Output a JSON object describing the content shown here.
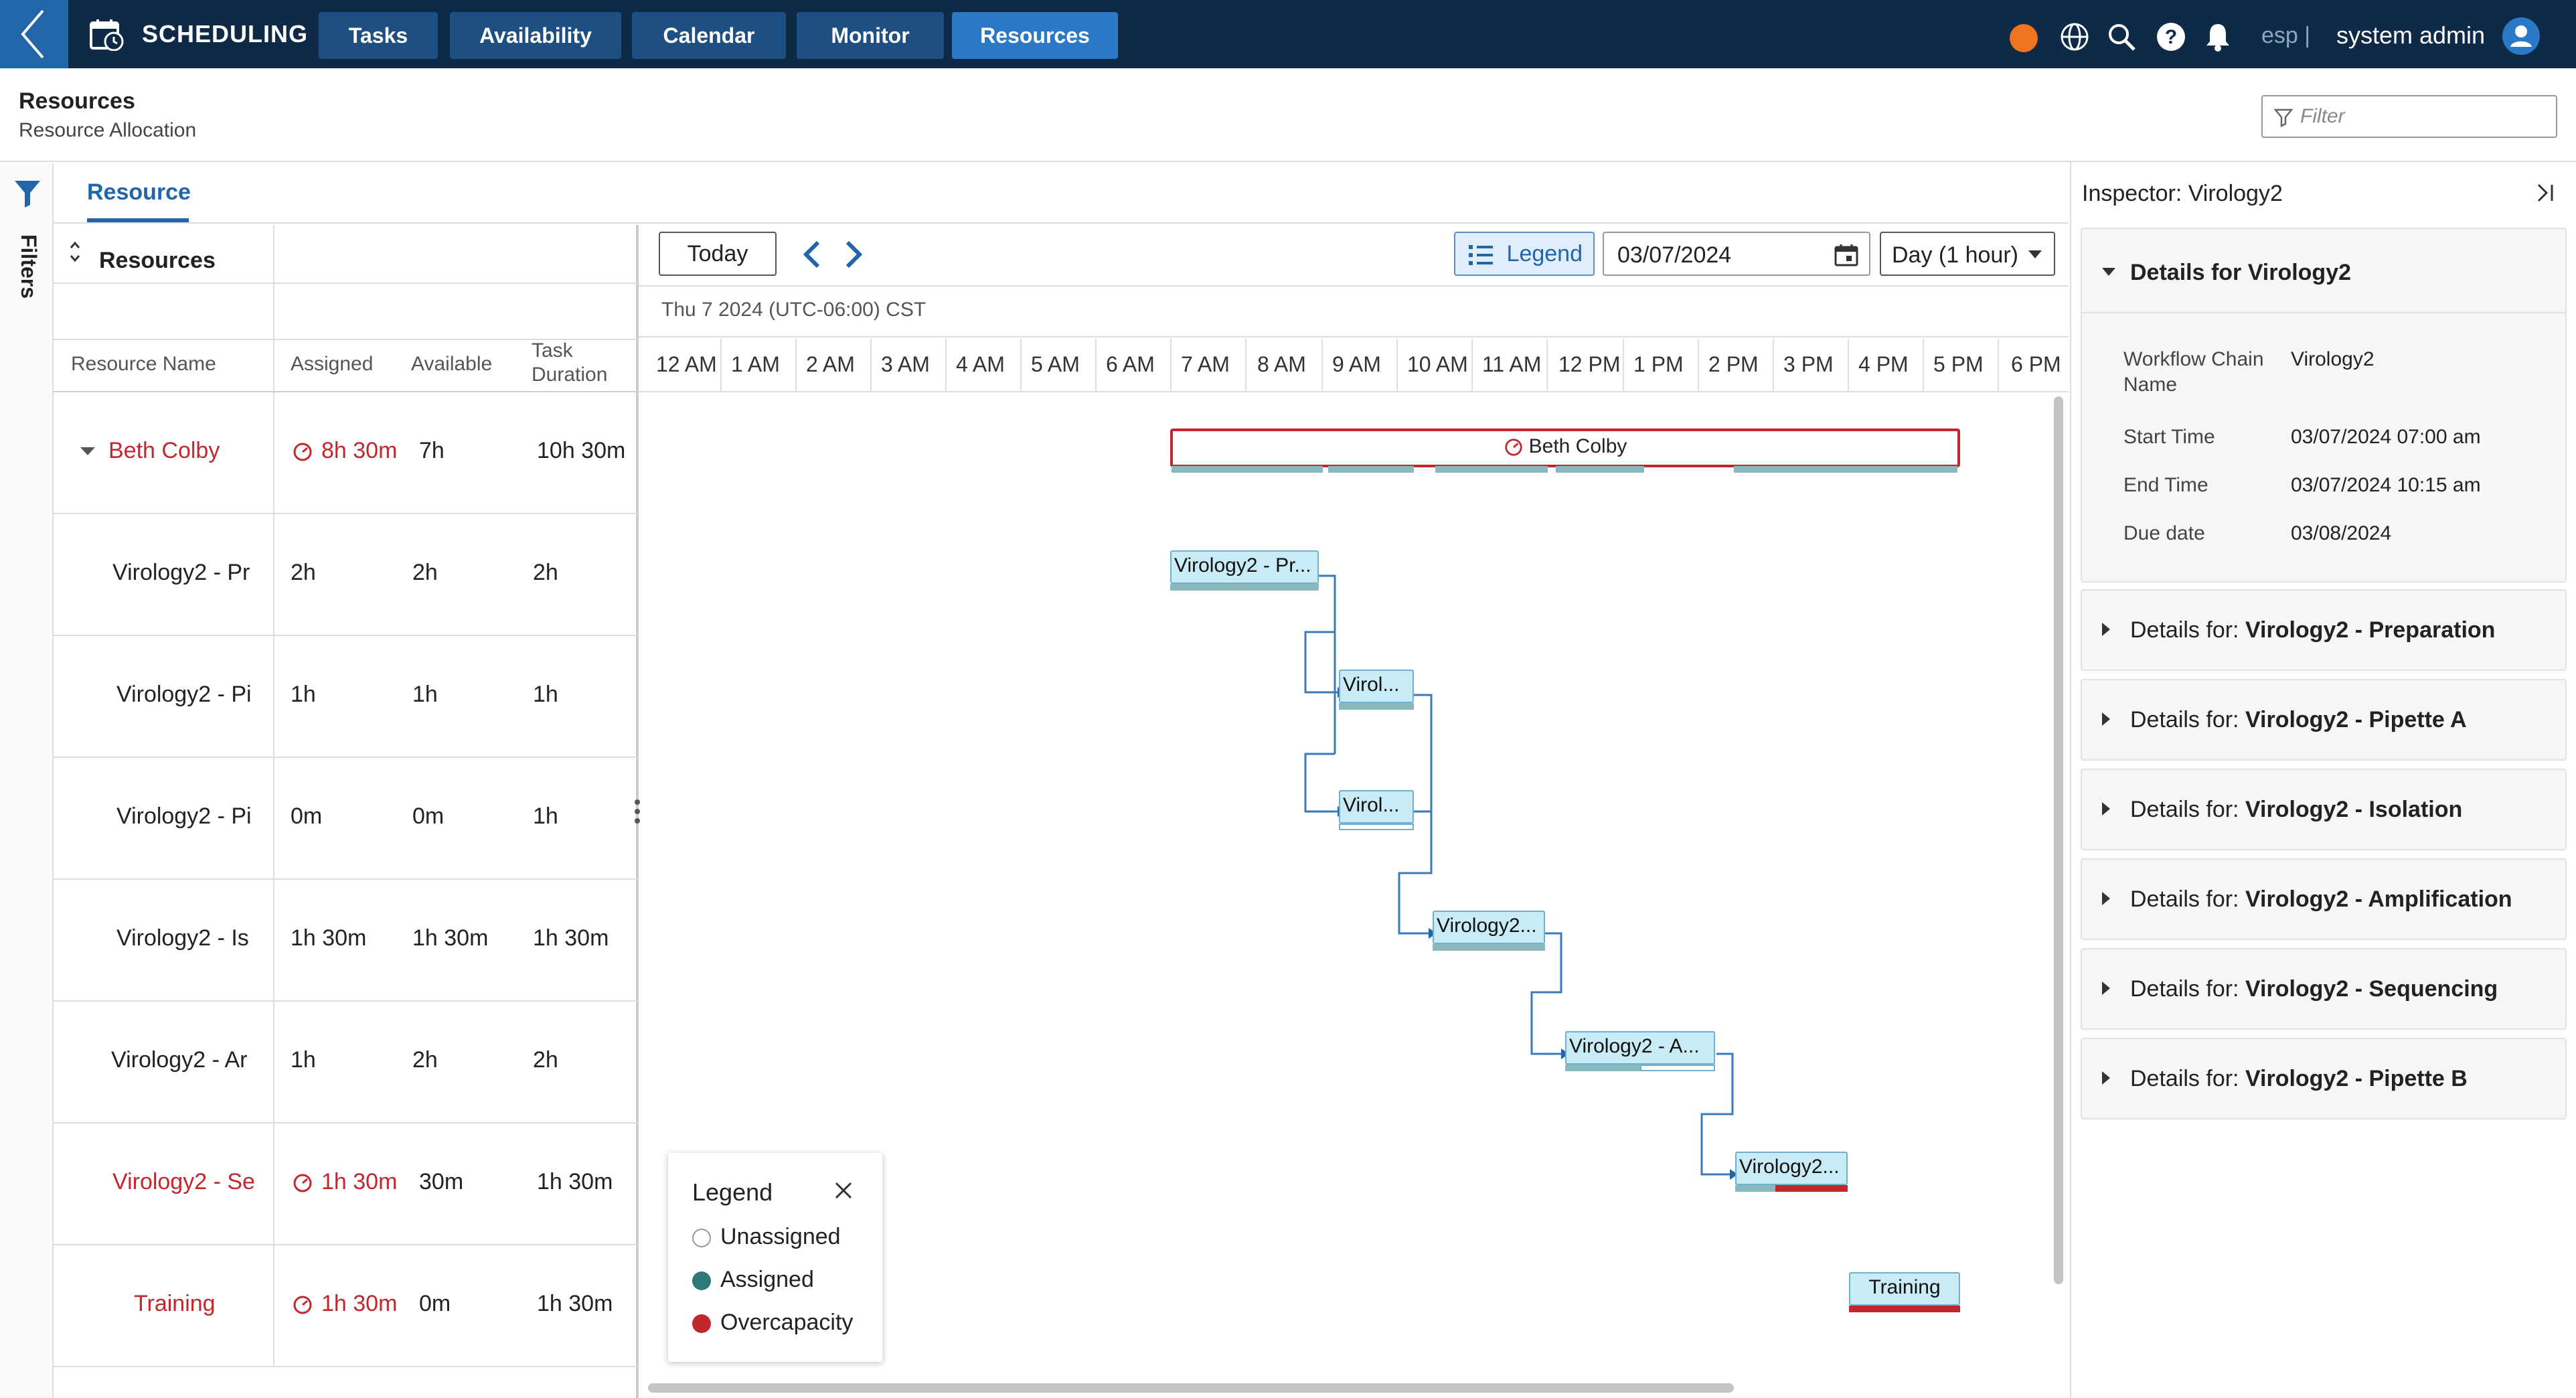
{
  "topbar": {
    "app_title": "SCHEDULING",
    "tabs": [
      {
        "label": "Tasks",
        "active": false
      },
      {
        "label": "Availability",
        "active": false
      },
      {
        "label": "Calendar",
        "active": false
      },
      {
        "label": "Monitor",
        "active": false
      },
      {
        "label": "Resources",
        "active": true
      }
    ],
    "status_color": "#f0731f",
    "language": "esp |",
    "user": "system admin"
  },
  "header": {
    "title": "Resources",
    "subtitle": "Resource Allocation",
    "filter_placeholder": "Filter"
  },
  "left_rail": {
    "label": "Filters"
  },
  "view_tab": "Resource",
  "grid": {
    "title": "Resources",
    "columns": [
      "Resource Name",
      "Assigned",
      "Available",
      "Task Duration"
    ],
    "rows": [
      {
        "name": "Beth Colby",
        "assigned": "8h 30m",
        "available": "7h",
        "duration": "10h 30m",
        "overcapacity": true,
        "expandable": true
      },
      {
        "name": "Virology2 - Pr",
        "assigned": "2h",
        "available": "2h",
        "duration": "2h",
        "overcapacity": false
      },
      {
        "name": "Virology2 - Pi",
        "assigned": "1h",
        "available": "1h",
        "duration": "1h",
        "overcapacity": false
      },
      {
        "name": "Virology2 - Pi",
        "assigned": "0m",
        "available": "0m",
        "duration": "1h",
        "overcapacity": false
      },
      {
        "name": "Virology2 - Is",
        "assigned": "1h 30m",
        "available": "1h 30m",
        "duration": "1h 30m",
        "overcapacity": false
      },
      {
        "name": "Virology2 - Ar",
        "assigned": "1h",
        "available": "2h",
        "duration": "2h",
        "overcapacity": false
      },
      {
        "name": "Virology2 - Se",
        "assigned": "1h 30m",
        "available": "30m",
        "duration": "1h 30m",
        "overcapacity": true
      },
      {
        "name": "Training",
        "assigned": "1h 30m",
        "available": "0m",
        "duration": "1h 30m",
        "overcapacity": true
      }
    ]
  },
  "gantt": {
    "today_label": "Today",
    "legend_label": "Legend",
    "date": "03/07/2024",
    "scale": "Day (1 hour)",
    "timezone": "Thu 7 2024 (UTC-06:00) CST",
    "hours": [
      "12 AM",
      "1 AM",
      "2 AM",
      "3 AM",
      "4 AM",
      "5 AM",
      "6 AM",
      "7 AM",
      "8 AM",
      "9 AM",
      "10 AM",
      "11 AM",
      "12 PM",
      "1 PM",
      "2 PM",
      "3 PM",
      "4 PM",
      "5 PM",
      "6 PM"
    ],
    "summary_label": "Beth Colby",
    "tasks": [
      {
        "label": "Virology2 - Pr..."
      },
      {
        "label": "Virol..."
      },
      {
        "label": "Virol..."
      },
      {
        "label": "Virology2..."
      },
      {
        "label": "Virology2 - A..."
      },
      {
        "label": "Virology2..."
      },
      {
        "label": "Training"
      }
    ]
  },
  "legend": {
    "title": "Legend",
    "items": [
      {
        "label": "Unassigned",
        "color": "#ffffff"
      },
      {
        "label": "Assigned",
        "color": "#2e7a78"
      },
      {
        "label": "Overcapacity",
        "color": "#c0282d"
      }
    ]
  },
  "inspector": {
    "title": "Inspector: Virology2",
    "details_head": "Details for Virology2",
    "fields": [
      {
        "key": "Workflow Chain Name",
        "value": "Virology2"
      },
      {
        "key": "Start Time",
        "value": "03/07/2024 07:00 am"
      },
      {
        "key": "End Time",
        "value": "03/07/2024 10:15 am"
      },
      {
        "key": "Due date",
        "value": "03/08/2024"
      }
    ],
    "collapsed_prefix": "Details for:",
    "collapsed": [
      "Virology2 - Preparation",
      "Virology2 - Pipette A",
      "Virology2 - Isolation",
      "Virology2 - Amplification",
      "Virology2 - Sequencing",
      "Virology2 - Pipette B"
    ]
  }
}
